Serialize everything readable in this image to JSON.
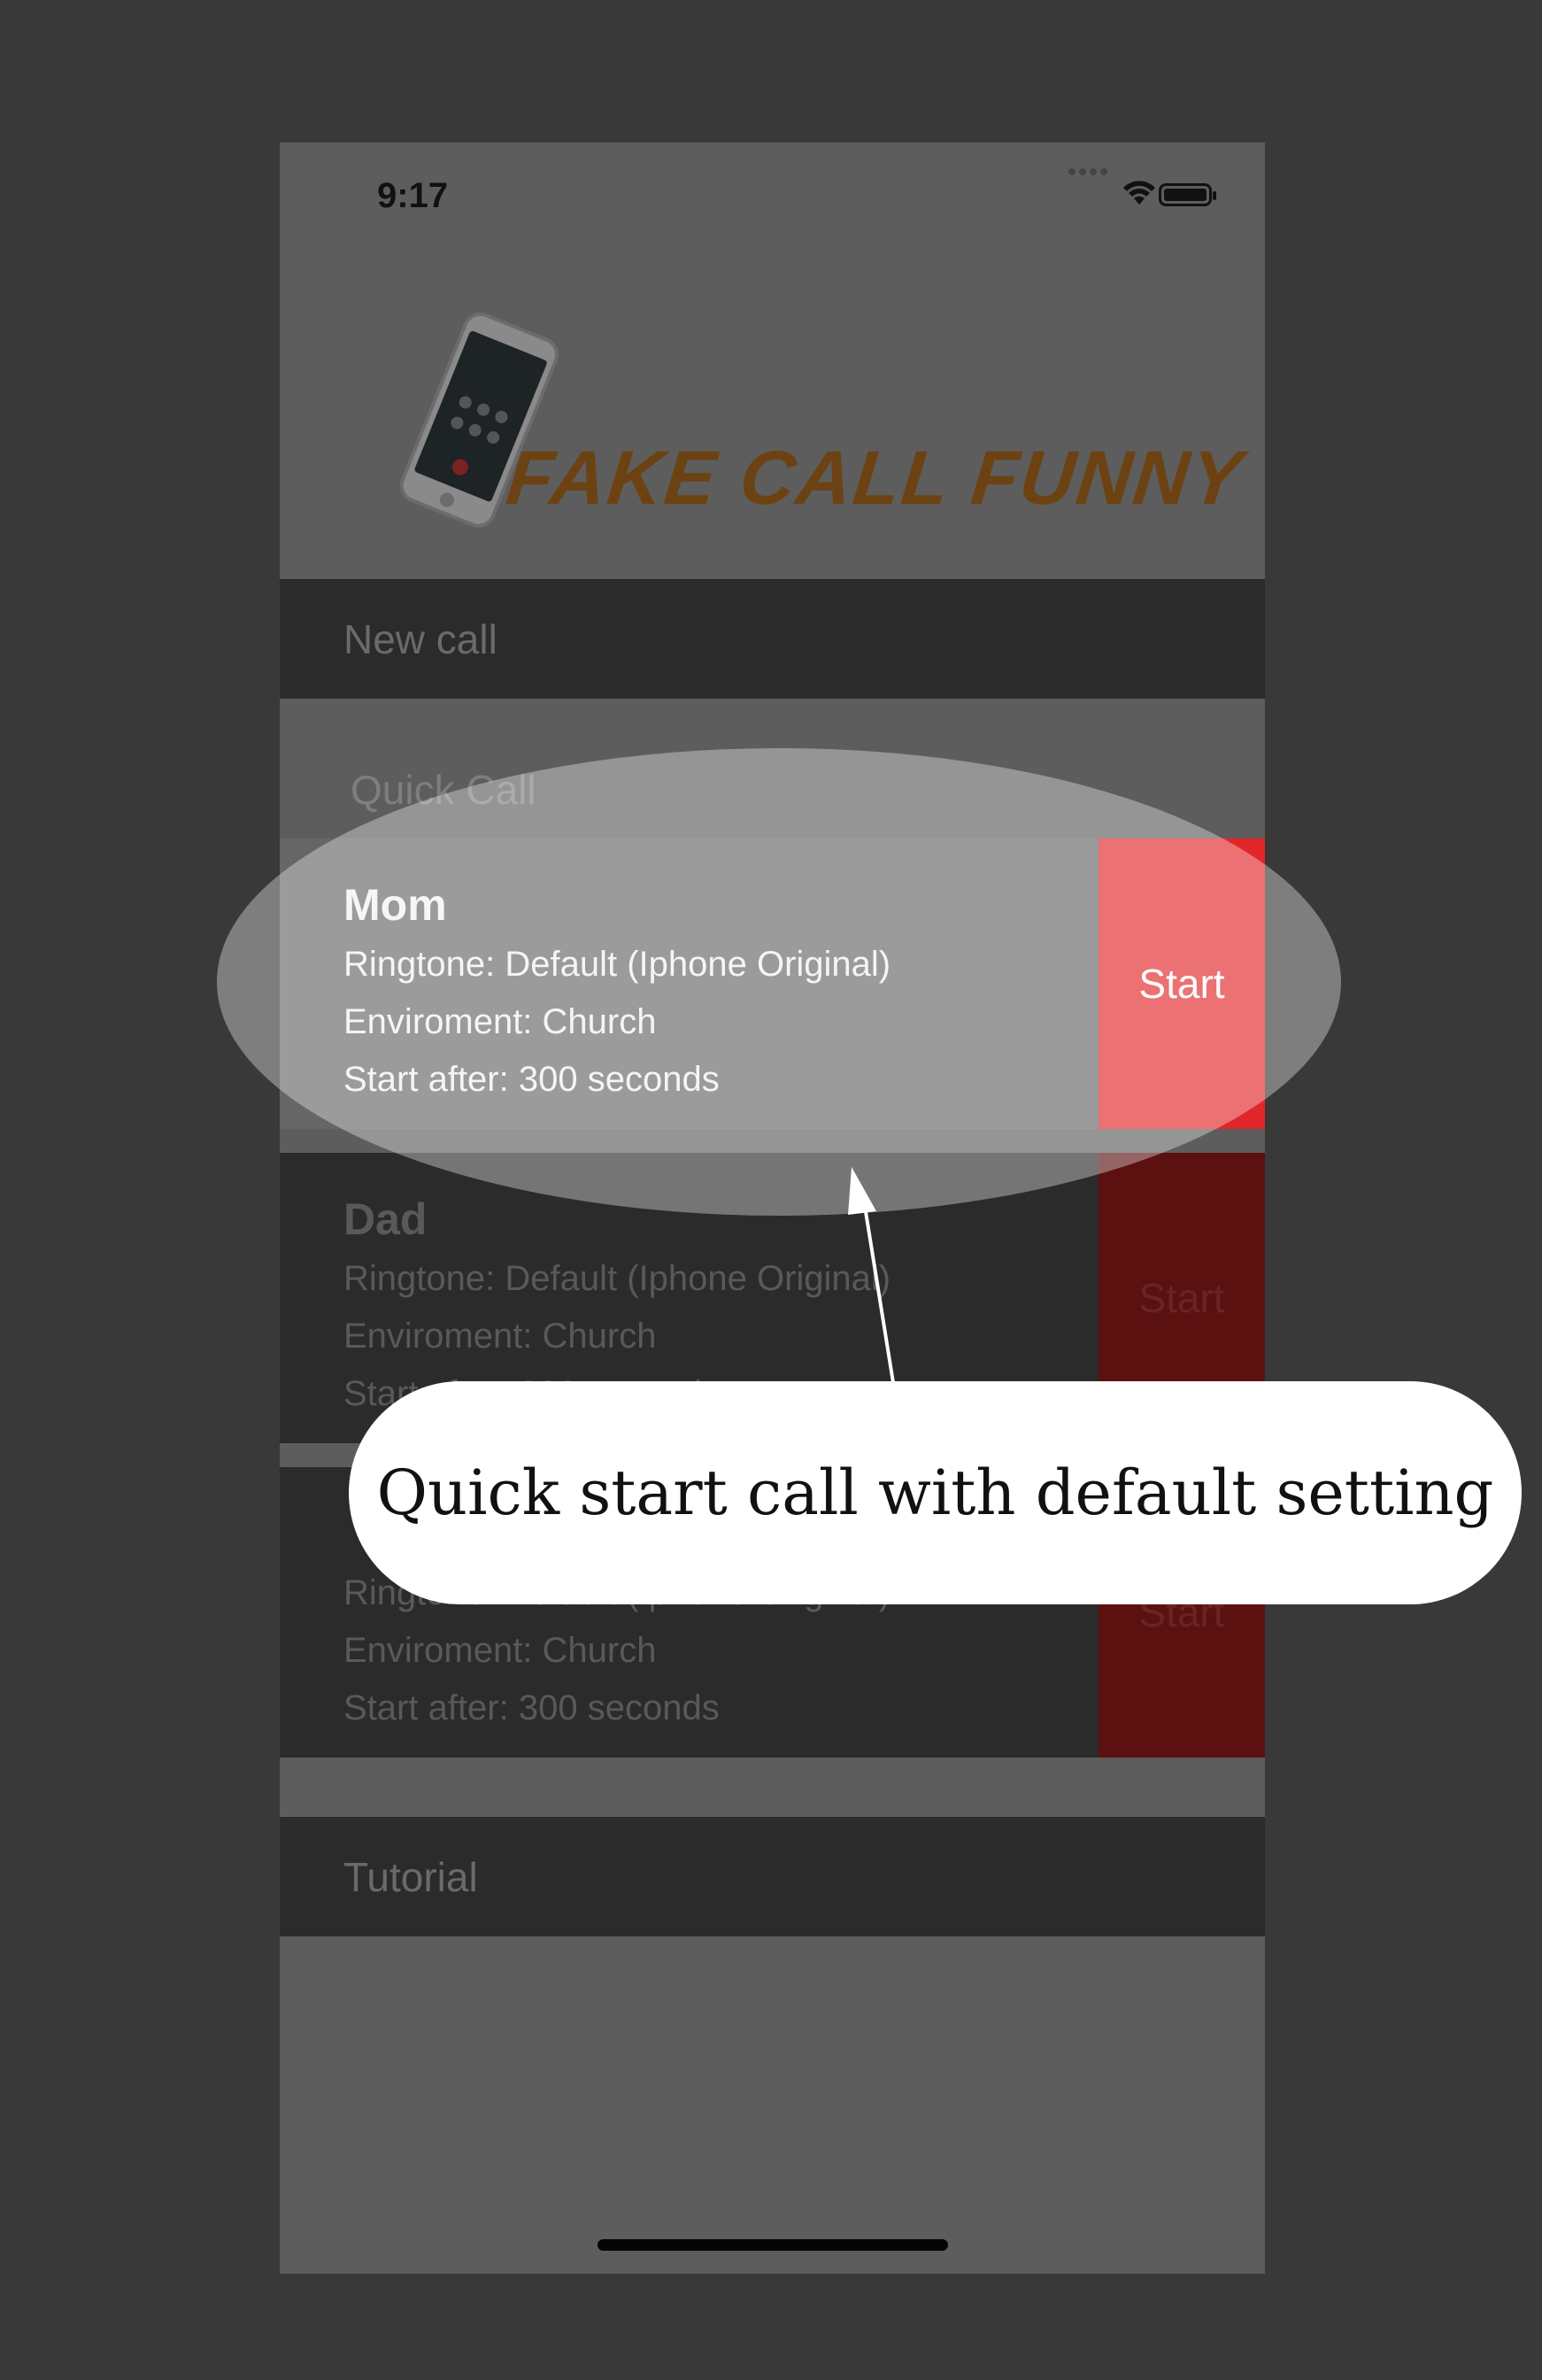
{
  "status_bar": {
    "time": "9:17"
  },
  "app": {
    "logo_text": "FAKE CALL FUNNY"
  },
  "menu": {
    "new_call": "New call",
    "quick_call_section": "Quick Call",
    "tutorial": "Tutorial"
  },
  "quick_calls": [
    {
      "name": "Mom",
      "ringtone": "Ringtone: Default (Iphone Original)",
      "environment": "Enviroment: Church",
      "start_after": "Start after: 300 seconds",
      "start_label": "Start"
    },
    {
      "name": "Dad",
      "ringtone": "Ringtone: Default (Iphone Original)",
      "environment": "Enviroment: Church",
      "start_after": "Start after: 300 seconds",
      "start_label": "Start"
    },
    {
      "name": "",
      "ringtone": "Ringtone: Default (Iphone Original)",
      "environment": "Enviroment: Church",
      "start_after": "Start after: 300 seconds",
      "start_label": "Start"
    }
  ],
  "annotation": {
    "callout_text": "Quick start call with default setting"
  },
  "colors": {
    "accent_red": "#e02628",
    "logo_brown": "#6d4212",
    "overlay_bg": "#393939"
  }
}
